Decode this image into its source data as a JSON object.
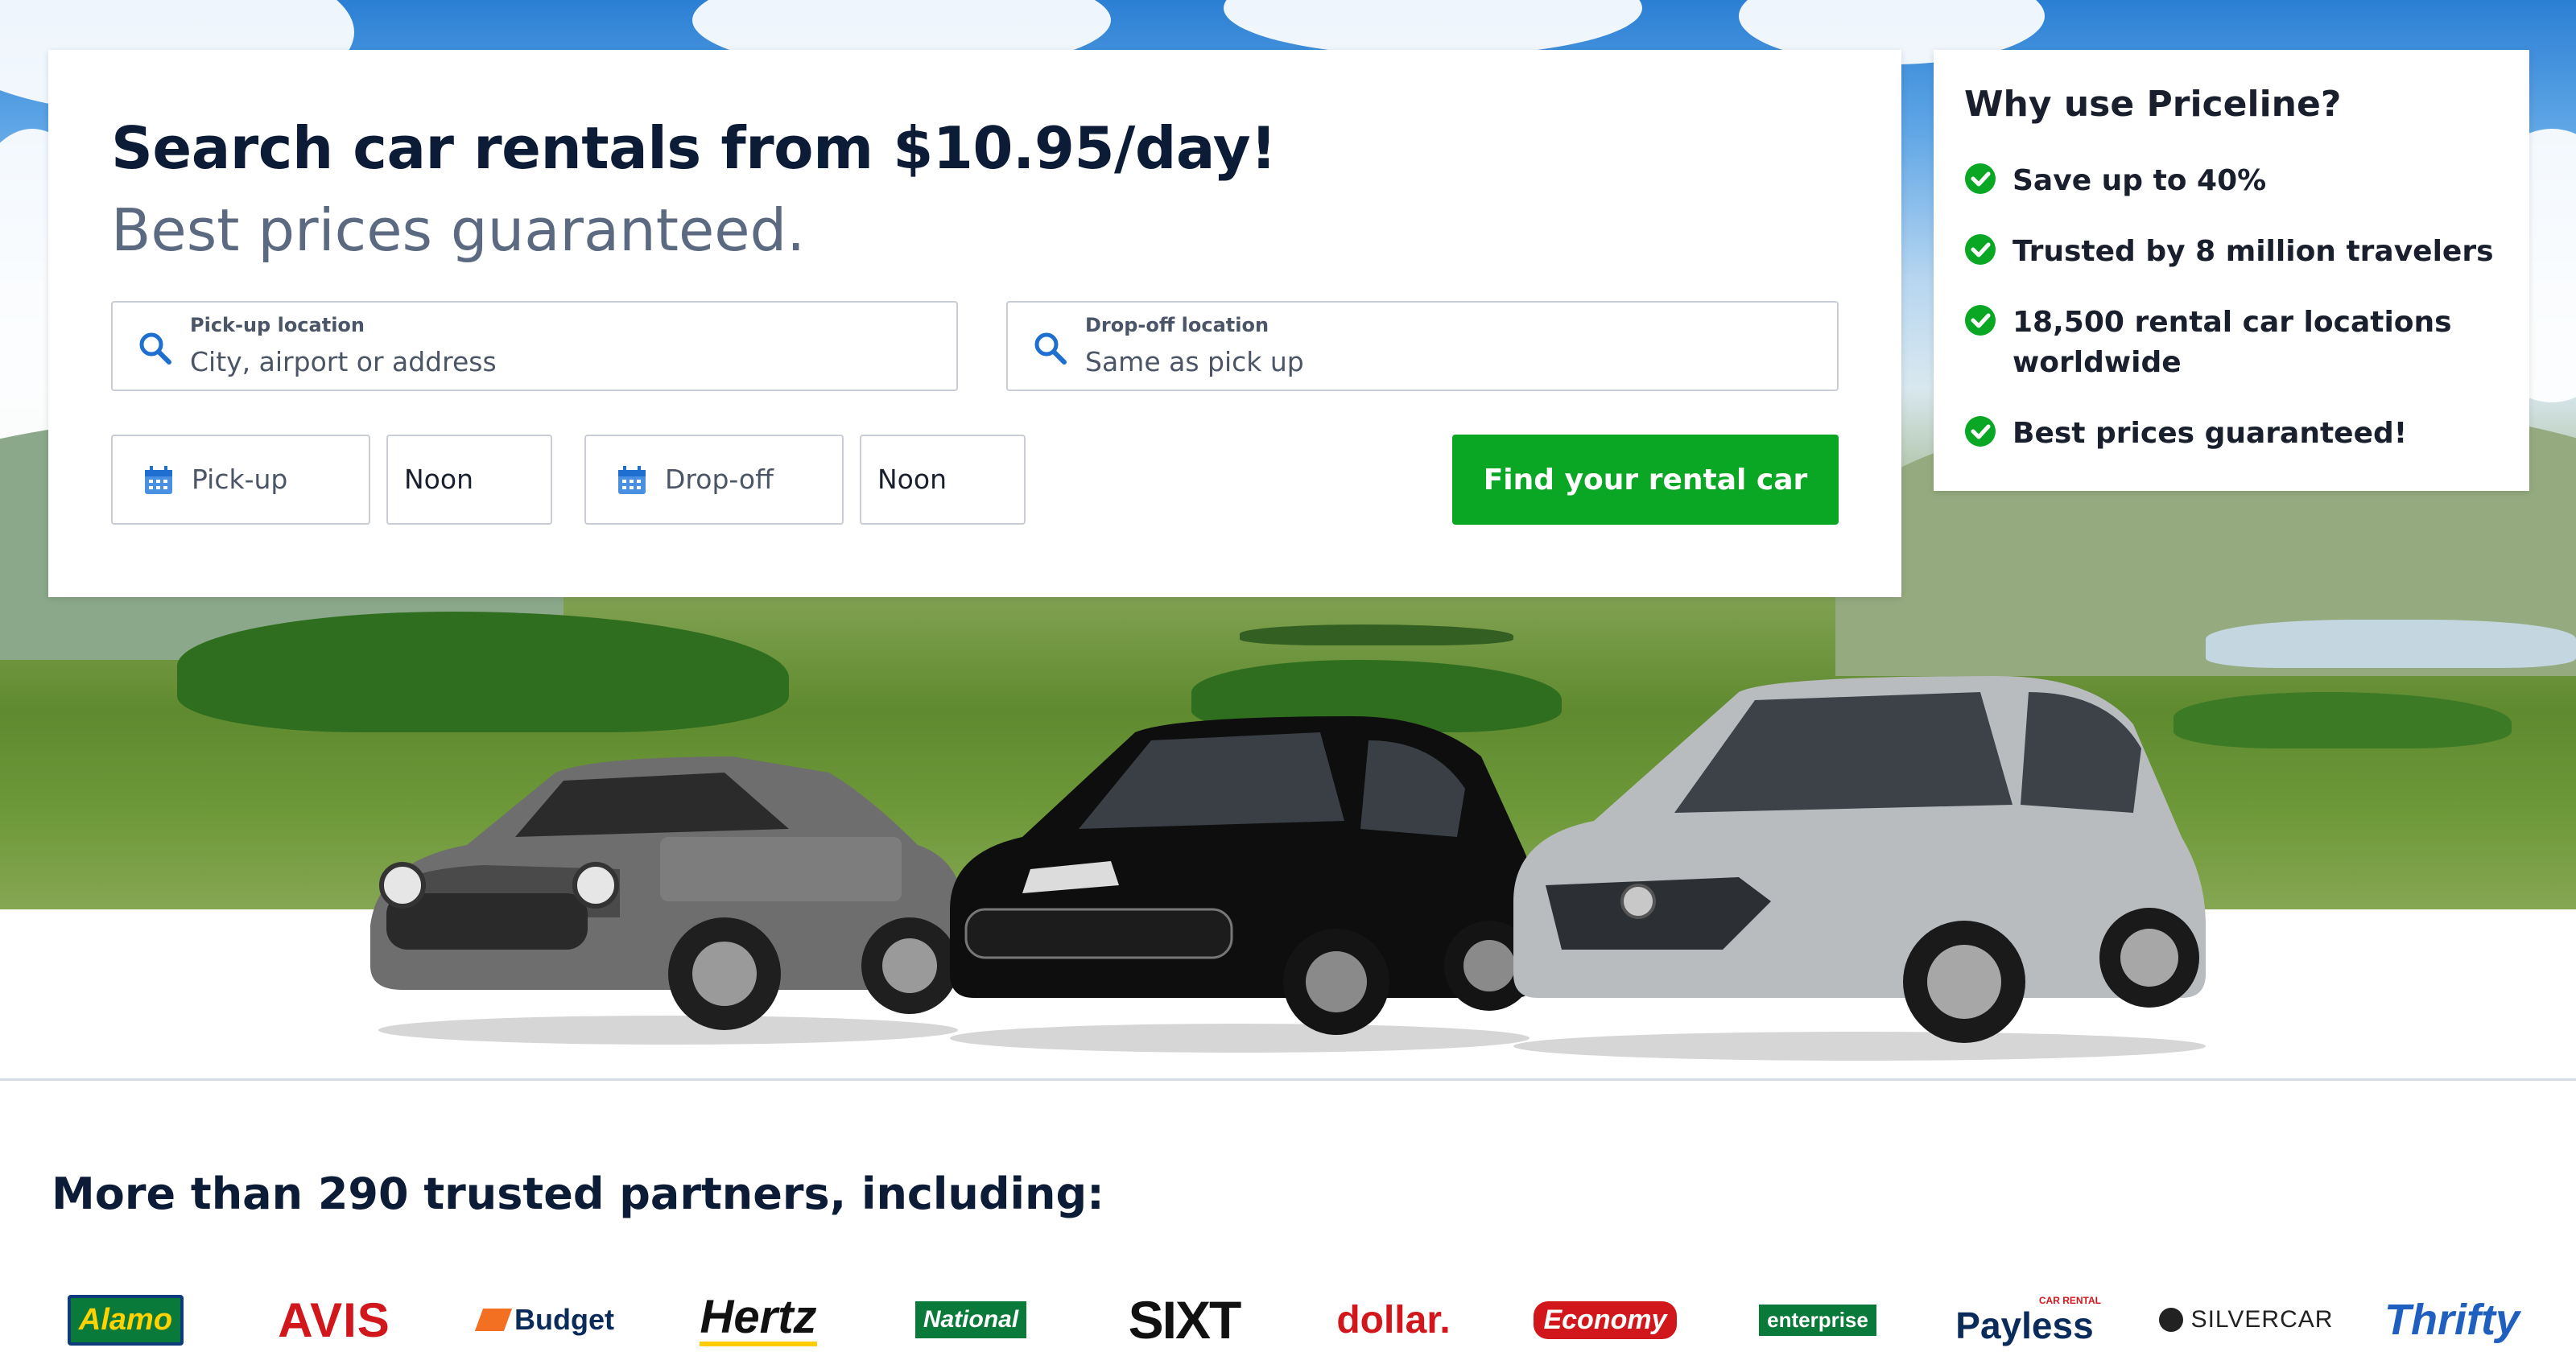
{
  "search": {
    "headline": "Search car rentals from $10.95/day!",
    "subhead": "Best prices guaranteed.",
    "pickup_location": {
      "label": "Pick-up location",
      "placeholder": "City, airport or address"
    },
    "dropoff_location": {
      "label": "Drop-off location",
      "placeholder": "Same as pick up"
    },
    "pickup_date": "Pick-up",
    "pickup_time": "Noon",
    "dropoff_date": "Drop-off",
    "dropoff_time": "Noon",
    "submit_label": "Find your rental car"
  },
  "why": {
    "title": "Why use Priceline?",
    "items": [
      {
        "text": "Save up to 40%"
      },
      {
        "text": "Trusted by 8 million travelers"
      },
      {
        "text": "18,500 rental car locations",
        "text2": "worldwide"
      },
      {
        "text": "Best prices guaranteed!"
      }
    ]
  },
  "partners": {
    "title": "More than 290 trusted partners, including:",
    "logos": [
      {
        "name": "Alamo"
      },
      {
        "name": "AVIS"
      },
      {
        "name": "Budget"
      },
      {
        "name": "Hertz"
      },
      {
        "name": "National"
      },
      {
        "name": "SIXT"
      },
      {
        "name": "dollar."
      },
      {
        "name": "Economy"
      },
      {
        "name": "enterprise"
      },
      {
        "name": "Payless",
        "tagline": "CAR RENTAL"
      },
      {
        "name": "SILVERCAR"
      },
      {
        "name": "Thrifty"
      }
    ]
  },
  "colors": {
    "accent_green": "#0aa724",
    "heading_navy": "#0c1b36",
    "subhead_gray": "#5b6a80",
    "icon_blue": "#1f6fd1"
  },
  "icons": {
    "location_search": "search-icon",
    "date": "calendar-icon",
    "benefit": "check-circle-icon"
  }
}
